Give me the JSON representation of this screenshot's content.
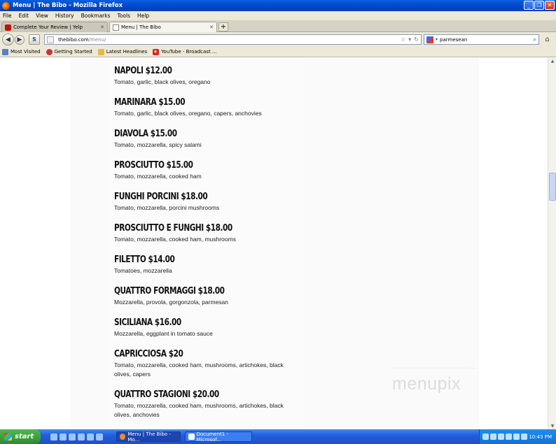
{
  "window": {
    "title": "Menu | The Bibo - Mozilla Firefox"
  },
  "menubar": [
    "File",
    "Edit",
    "View",
    "History",
    "Bookmarks",
    "Tools",
    "Help"
  ],
  "tabs": [
    {
      "label": "Complete Your Review | Yelp"
    },
    {
      "label": "Menu | The Bibo"
    }
  ],
  "nav": {
    "url_host": "thebibo.com",
    "url_path": "/menu/",
    "search_value": "parmesean"
  },
  "bookmarks": [
    "Most Visited",
    "Getting Started",
    "Latest Headlines",
    "YouTube - Broadcast ..."
  ],
  "menu_items": [
    {
      "name": "NAPOLI $12.00",
      "desc": "Tomato, garlic, black olives, oregano"
    },
    {
      "name": "MARINARA $15.00",
      "desc": "Tomato, garlic, black olives, oregano, capers, anchovies"
    },
    {
      "name": "DIAVOLA $15.00",
      "desc": "Tomato, mozzarella, spicy salami"
    },
    {
      "name": "PROSCIUTTO $15.00",
      "desc": "Tomato, mozzarella, cooked ham"
    },
    {
      "name": "FUNGHI PORCINI $18.00",
      "desc": "Tomato, mozzarella, porcini mushrooms"
    },
    {
      "name": "PROSCIUTTO E FUNGHI $18.00",
      "desc": "Tomato, mozzarella, cooked ham, mushrooms"
    },
    {
      "name": "FILETTO $14.00",
      "desc": "Tomatoes, mozzarella"
    },
    {
      "name": "QUATTRO FORMAGGI $18.00",
      "desc": "Mozzarella, provola, gorgonzola, parmesan"
    },
    {
      "name": "SICILIANA $16.00",
      "desc": "Mozzarella, eggplant in tomato sauce"
    },
    {
      "name": "CAPRICCIOSA $20",
      "desc": "Tomato, mozzarella, cooked ham, mushrooms, artichokes, black olives, capers"
    },
    {
      "name": "QUATTRO STAGIONI $20.00",
      "desc": "Tomato, mozzarella, cooked ham, mushrooms, artichokes, black olives, anchovies"
    }
  ],
  "watermark": "menupix",
  "taskbar": {
    "start_label": "start",
    "tasks": [
      "Menu | The Bibo - Mo...",
      "Document1 - Microsof..."
    ],
    "clock": "10:43 PM"
  }
}
